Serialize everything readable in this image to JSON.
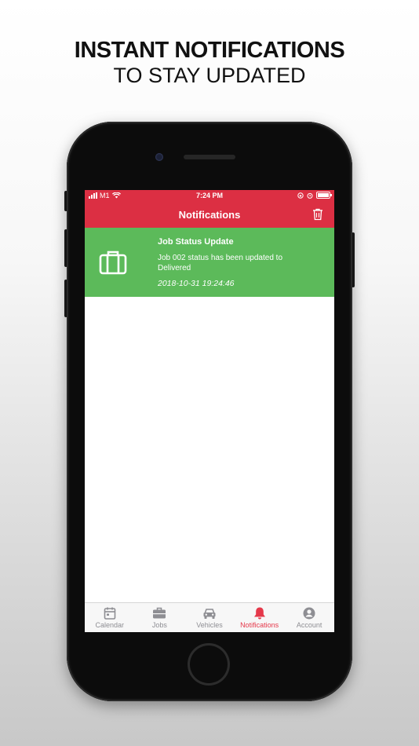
{
  "headline": {
    "line1": "INSTANT NOTIFICATIONS",
    "line2": "TO STAY UPDATED"
  },
  "status_bar": {
    "carrier": "M1",
    "time": "7:24 PM"
  },
  "nav": {
    "title": "Notifications",
    "trash_icon": "trash-icon"
  },
  "notifications": [
    {
      "icon": "briefcase-icon",
      "title": "Job Status Update",
      "body": "Job 002 status has been updated to Delivered",
      "timestamp": "2018-10-31 19:24:46"
    }
  ],
  "tabs": [
    {
      "label": "Calendar",
      "icon": "calendar-icon",
      "active": false
    },
    {
      "label": "Jobs",
      "icon": "briefcase-icon",
      "active": false
    },
    {
      "label": "Vehicles",
      "icon": "car-icon",
      "active": false
    },
    {
      "label": "Notifications",
      "icon": "bell-icon",
      "active": true
    },
    {
      "label": "Account",
      "icon": "account-icon",
      "active": false
    }
  ],
  "colors": {
    "header_red": "#dc2f43",
    "notification_green": "#5cba5a",
    "tab_active": "#e5384a",
    "tab_inactive": "#8e8e93"
  }
}
